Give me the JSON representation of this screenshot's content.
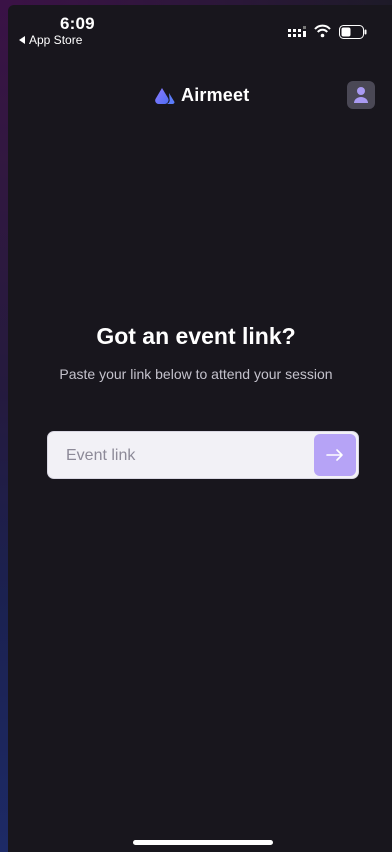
{
  "status_bar": {
    "time": "6:09",
    "back_app_label": "App Store"
  },
  "header": {
    "brand": "Airmeet",
    "brand_color": "#6c5ce7"
  },
  "main": {
    "title": "Got an event link?",
    "subtitle": "Paste your link below to attend your session",
    "event_link": {
      "value": "",
      "placeholder": "Event link"
    }
  },
  "colors": {
    "background": "#18161d",
    "input_bg": "#f2f1f6",
    "submit_button": "#b6a3f6"
  },
  "icons": [
    "back-arrow-icon",
    "signal-icon",
    "wifi-icon",
    "battery-icon",
    "airmeet-logo-icon",
    "profile-icon",
    "arrow-right-icon"
  ]
}
